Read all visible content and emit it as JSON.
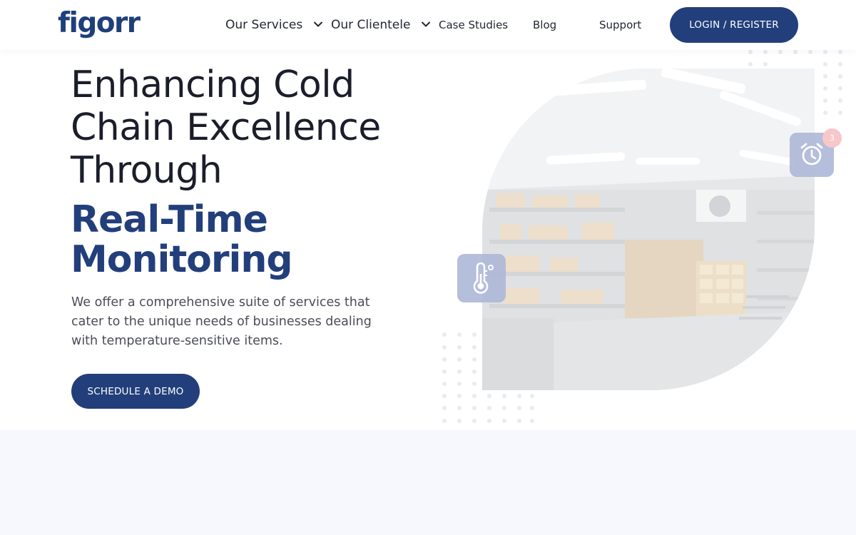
{
  "header": {
    "logo_text": "figorr",
    "nav": [
      {
        "label": "Our Services",
        "has_dropdown": true
      },
      {
        "label": "Our Clientele",
        "has_dropdown": true
      },
      {
        "label": "Case Studies",
        "has_dropdown": false
      },
      {
        "label": "Blog",
        "has_dropdown": false
      },
      {
        "label": "Support",
        "has_dropdown": false
      }
    ],
    "login_label": "LOGIN / REGISTER"
  },
  "hero": {
    "title_lines": [
      "Enhancing Cold",
      "Chain Excellence",
      "Through"
    ],
    "accent_lines": [
      "Real-Time",
      "Monitoring"
    ],
    "description": "We offer a comprehensive suite of services that cater to the unique needs of businesses dealing with temperature-sensitive items.",
    "cta_label": "SCHEDULE A DEMO",
    "notification_count": "3",
    "icons": [
      "thermometer-icon",
      "alarm-clock-icon"
    ]
  },
  "colors": {
    "brand": "#223f7b",
    "text": "#1b1e2a",
    "muted": "#4a4d57",
    "lower_section_bg": "#f7f8fd",
    "badge": "#f7c7c9"
  }
}
